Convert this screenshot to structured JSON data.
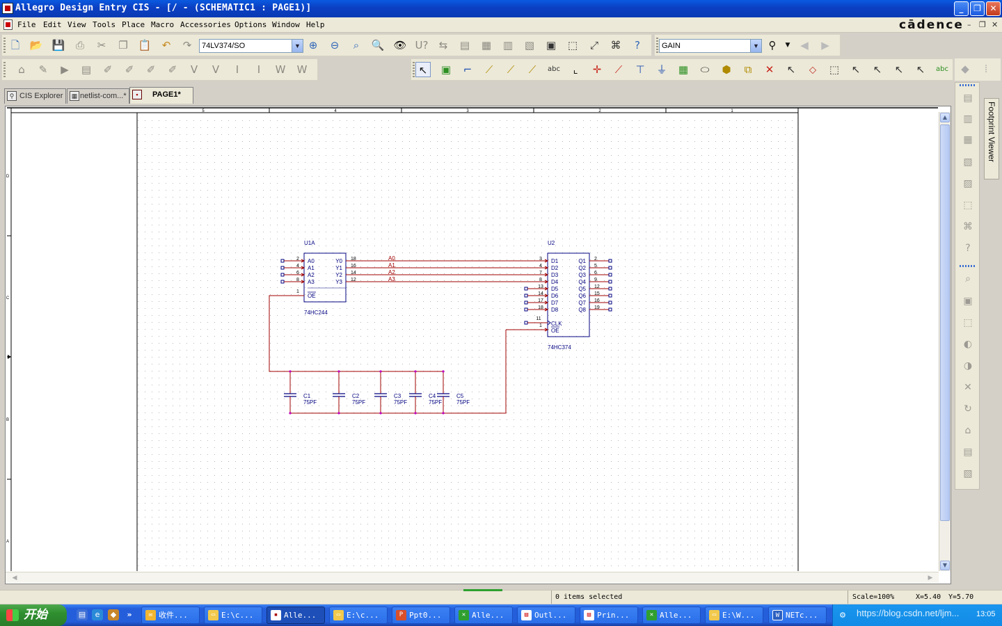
{
  "window": {
    "title": "Allegro Design Entry CIS - [/ - (SCHEMATIC1 : PAGE1)]",
    "minimize": "_",
    "maximize": "❐",
    "close": "✕"
  },
  "menubar": {
    "items": [
      "File",
      "Edit",
      "View",
      "Tools",
      "Place",
      "Macro",
      "Accessories",
      "Options",
      "Window",
      "Help"
    ],
    "brand": "cādence",
    "mdi": [
      "–",
      "❐",
      "✕"
    ]
  },
  "toolbar": {
    "part_combo": "74LV374/SO",
    "search_combo": "GAIN"
  },
  "tabs": [
    {
      "label": "CIS Explorer"
    },
    {
      "label": "netlist-com...*"
    },
    {
      "label": "PAGE1*"
    }
  ],
  "side_panel": {
    "footprint_viewer": "Footprint Viewer"
  },
  "schematic": {
    "border_columns": [
      "5",
      "4",
      "3",
      "2",
      "1"
    ],
    "border_rows": [
      "D",
      "C",
      "B",
      "A"
    ],
    "net_color": "#a00000",
    "wire_color": "#a00000",
    "part_color": "#000080",
    "u1": {
      "refdes": "U1A",
      "value": "74HC244",
      "inputs": [
        {
          "pin": "2",
          "name": "A0"
        },
        {
          "pin": "4",
          "name": "A1"
        },
        {
          "pin": "6",
          "name": "A2"
        },
        {
          "pin": "8",
          "name": "A3"
        }
      ],
      "outputs": [
        {
          "pin": "18",
          "name": "Y0"
        },
        {
          "pin": "16",
          "name": "Y1"
        },
        {
          "pin": "14",
          "name": "Y2"
        },
        {
          "pin": "12",
          "name": "Y3"
        }
      ],
      "oe": {
        "pin": "1",
        "name": "OE"
      }
    },
    "u2": {
      "refdes": "U2",
      "value": "74HC374",
      "inputs": [
        {
          "pin": "3",
          "name": "D1"
        },
        {
          "pin": "4",
          "name": "D2"
        },
        {
          "pin": "7",
          "name": "D3"
        },
        {
          "pin": "8",
          "name": "D4"
        },
        {
          "pin": "13",
          "name": "D5"
        },
        {
          "pin": "14",
          "name": "D6"
        },
        {
          "pin": "17",
          "name": "D7"
        },
        {
          "pin": "18",
          "name": "D8"
        }
      ],
      "outputs": [
        {
          "pin": "2",
          "name": "Q1"
        },
        {
          "pin": "5",
          "name": "Q2"
        },
        {
          "pin": "6",
          "name": "Q3"
        },
        {
          "pin": "9",
          "name": "Q4"
        },
        {
          "pin": "12",
          "name": "Q5"
        },
        {
          "pin": "15",
          "name": "Q6"
        },
        {
          "pin": "16",
          "name": "Q7"
        },
        {
          "pin": "19",
          "name": "Q8"
        }
      ],
      "clk": {
        "pin": "11",
        "name": "CLK"
      },
      "oe": {
        "pin": "1",
        "name": "OE"
      }
    },
    "net_labels": [
      "A0",
      "A1",
      "A2",
      "A3"
    ],
    "capacitors": [
      {
        "ref": "C1",
        "value": "75PF"
      },
      {
        "ref": "C2",
        "value": "75PF"
      },
      {
        "ref": "C3",
        "value": "75PF"
      },
      {
        "ref": "C4",
        "value": "75PF"
      },
      {
        "ref": "C5",
        "value": "75PF"
      }
    ]
  },
  "statusbar": {
    "selection": "0 items selected",
    "scale": "Scale=100%",
    "x": "X=5.40",
    "y": "Y=5.70"
  },
  "taskbar": {
    "start": "开始",
    "tasks": [
      "收件...",
      "E:\\c...",
      "Alle...",
      "E:\\c...",
      "Ppt0...",
      "Alle...",
      "Outl...",
      "Prin...",
      "Alle...",
      "E:\\W...",
      "NETc..."
    ],
    "tray_text": "https://blog.csdn.net/ljm...",
    "clock": "13:05"
  }
}
